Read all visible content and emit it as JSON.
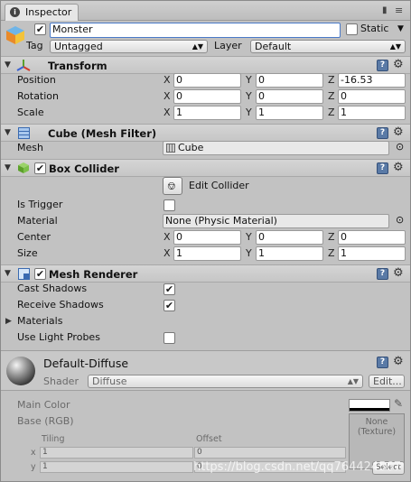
{
  "window": {
    "tab_title": "Inspector"
  },
  "object": {
    "name": "Monster",
    "static_label": "Static",
    "tag_label": "Tag",
    "tag_value": "Untagged",
    "layer_label": "Layer",
    "layer_value": "Default"
  },
  "transform": {
    "title": "Transform",
    "position": {
      "label": "Position",
      "x": "0",
      "y": "0",
      "z": "-16.53"
    },
    "rotation": {
      "label": "Rotation",
      "x": "0",
      "y": "0",
      "z": "0"
    },
    "scale": {
      "label": "Scale",
      "x": "1",
      "y": "1",
      "z": "1"
    }
  },
  "mesh_filter": {
    "title": "Cube (Mesh Filter)",
    "mesh_label": "Mesh",
    "mesh_value": "Cube"
  },
  "box_collider": {
    "title": "Box Collider",
    "edit_collider_label": "Edit Collider",
    "is_trigger_label": "Is Trigger",
    "material_label": "Material",
    "material_value": "None (Physic Material)",
    "center": {
      "label": "Center",
      "x": "0",
      "y": "0",
      "z": "0"
    },
    "size": {
      "label": "Size",
      "x": "1",
      "y": "1",
      "z": "1"
    }
  },
  "mesh_renderer": {
    "title": "Mesh Renderer",
    "cast_shadows_label": "Cast Shadows",
    "receive_shadows_label": "Receive Shadows",
    "materials_label": "Materials",
    "use_light_probes_label": "Use Light Probes"
  },
  "material": {
    "name": "Default-Diffuse",
    "shader_label": "Shader",
    "shader_value": "Diffuse",
    "edit_button": "Edit...",
    "main_color_label": "Main Color",
    "base_label": "Base (RGB)",
    "texture_slot": "None\n(Texture)",
    "tiling_label": "Tiling",
    "offset_label": "Offset",
    "tiling_x": "1",
    "tiling_y": "1",
    "offset_x": "0",
    "offset_y": "0",
    "row_x": "x",
    "row_y": "y",
    "select_button": "Select"
  },
  "axes": {
    "x": "X",
    "y": "Y",
    "z": "Z"
  },
  "watermark": "https://blog.csdn.net/qq764424567"
}
